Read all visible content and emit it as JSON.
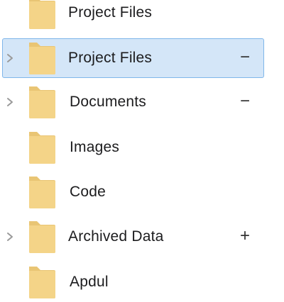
{
  "colors": {
    "folder_front": "#f4d488",
    "folder_back": "#e9c574",
    "selection_bg": "#d4e6f8",
    "selection_border": "#7fb6ea",
    "chevron": "#9a9a9a"
  },
  "tree": {
    "items": [
      {
        "label": "Project Files",
        "chevron": false,
        "action": "",
        "selected": false
      },
      {
        "label": "Project Files",
        "chevron": true,
        "action": "−",
        "selected": true
      },
      {
        "label": "Documents",
        "chevron": true,
        "action": "−",
        "selected": false
      },
      {
        "label": "Images",
        "chevron": false,
        "action": "",
        "selected": false
      },
      {
        "label": "Code",
        "chevron": false,
        "action": "",
        "selected": false
      },
      {
        "label": "Archived Data",
        "chevron": true,
        "action": "+",
        "selected": false
      },
      {
        "label": "Apdul",
        "chevron": false,
        "action": "",
        "selected": false
      }
    ]
  }
}
